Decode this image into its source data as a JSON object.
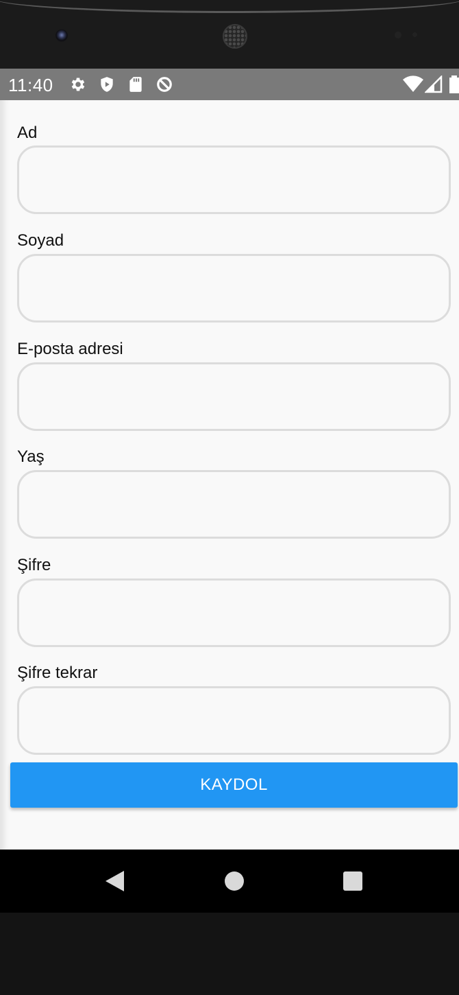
{
  "status_bar": {
    "time": "11:40",
    "left_icons": [
      "settings-icon",
      "play-protect-icon",
      "sd-card-icon",
      "data-saver-icon"
    ],
    "right_icons": [
      "wifi-icon",
      "cell-signal-icon",
      "battery-icon"
    ]
  },
  "form": {
    "fields": [
      {
        "label": "Ad",
        "value": "",
        "placeholder": ""
      },
      {
        "label": "Soyad",
        "value": "",
        "placeholder": ""
      },
      {
        "label": "E-posta adresi",
        "value": "",
        "placeholder": ""
      },
      {
        "label": "Yaş",
        "value": "",
        "placeholder": ""
      },
      {
        "label": "Şifre",
        "value": "",
        "placeholder": ""
      },
      {
        "label": "Şifre tekrar",
        "value": "",
        "placeholder": ""
      }
    ],
    "submit_label": "KAYDOL"
  },
  "colors": {
    "accent": "#2196f3",
    "status_bar": "#7a7a7a",
    "background": "#f9f9f9",
    "input_border": "#dcdcdc"
  },
  "navigation": {
    "buttons": [
      "back-icon",
      "home-icon",
      "recents-icon"
    ]
  }
}
